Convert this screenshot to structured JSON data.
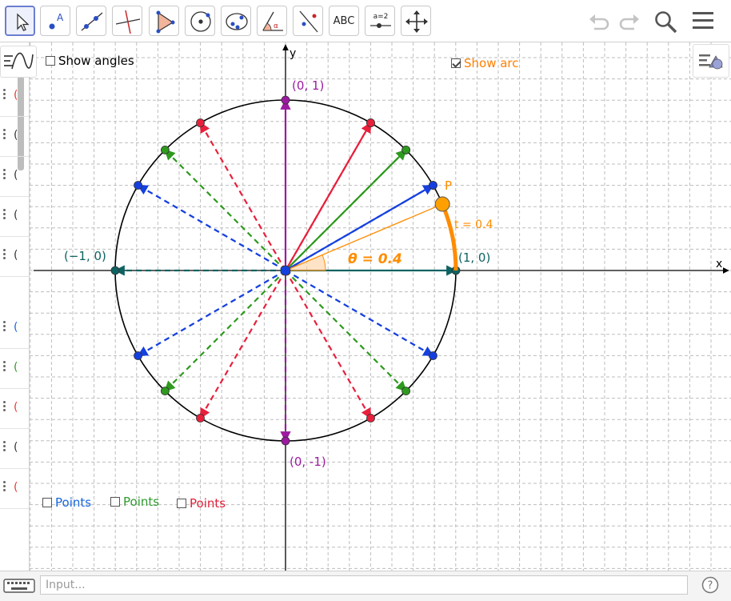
{
  "toolbar": {
    "tools": [
      {
        "name": "move-tool",
        "icon": "cursor-icon"
      },
      {
        "name": "point-tool",
        "icon": "point-icon",
        "label": "A"
      },
      {
        "name": "line-tool",
        "icon": "line-icon"
      },
      {
        "name": "perpendicular-tool",
        "icon": "perpendicular-icon"
      },
      {
        "name": "polygon-tool",
        "icon": "polygon-icon"
      },
      {
        "name": "circle-tool",
        "icon": "circle-center-icon"
      },
      {
        "name": "ellipse-tool",
        "icon": "ellipse-icon"
      },
      {
        "name": "angle-tool",
        "icon": "angle-icon"
      },
      {
        "name": "reflect-tool",
        "icon": "reflect-icon"
      },
      {
        "name": "text-tool",
        "icon": "text-icon",
        "label": "ABC"
      },
      {
        "name": "slider-tool",
        "icon": "slider-icon",
        "label": "a=2"
      },
      {
        "name": "move-view-tool",
        "icon": "move-view-icon"
      }
    ],
    "undo_icon": "undo-icon",
    "redo_icon": "redo-icon",
    "search_icon": "search-icon",
    "menu_icon": "menu-icon"
  },
  "graphics": {
    "checkboxes": {
      "show_angles": {
        "label": "Show angles",
        "checked": false
      },
      "show_arc": {
        "label": "Show arc",
        "checked": true,
        "color": "#ff7f00"
      },
      "points_blue": {
        "label": "Points",
        "checked": false,
        "color": "#1565e0"
      },
      "points_green": {
        "label": "Points",
        "checked": false,
        "color": "#2e9a2e"
      },
      "points_red": {
        "label": "Points",
        "checked": false,
        "color": "#e0203a"
      }
    },
    "axis_labels": {
      "x": "x",
      "y": "y"
    },
    "point_labels": {
      "top": "(0, 1)",
      "bottom": "(0, -1)",
      "left": "(−1, 0)",
      "right": "(1, 0)",
      "p": "P",
      "t": "t = 0.4",
      "theta": "θ = 0.4"
    },
    "unit_circle": {
      "theta": 0.4,
      "colors": {
        "axis_vec": "#0f6262",
        "vertical": "#9c1aa0",
        "red": "#e8203c",
        "green": "#2e9a1e",
        "blue": "#1540e0",
        "arc": "#ff8c00"
      },
      "red_angles": [
        60,
        120,
        240,
        300
      ],
      "green_angles": [
        45,
        135,
        225,
        315
      ],
      "blue_angles": [
        30,
        150,
        210,
        330
      ]
    }
  },
  "input_bar": {
    "placeholder": "Input...",
    "keyboard_icon": "keyboard-icon",
    "help_icon": "help-icon"
  }
}
